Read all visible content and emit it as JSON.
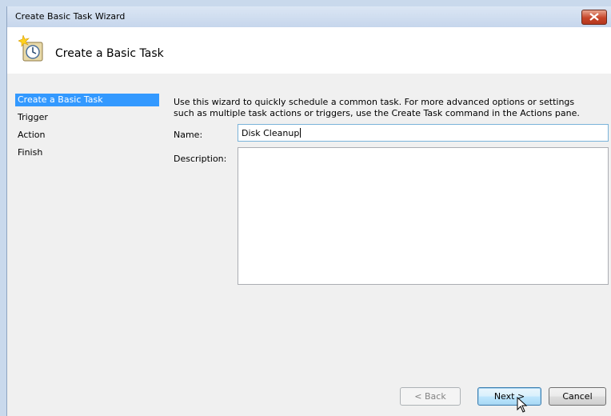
{
  "window": {
    "title": "Create Basic Task Wizard"
  },
  "header": {
    "title": "Create a Basic Task",
    "icon": "scheduled-task-clock-icon"
  },
  "steps": [
    {
      "label": "Create a Basic Task",
      "active": true
    },
    {
      "label": "Trigger",
      "active": false
    },
    {
      "label": "Action",
      "active": false
    },
    {
      "label": "Finish",
      "active": false
    }
  ],
  "main": {
    "intro_line1": "Use this wizard to quickly schedule a common task.  For more advanced options or settings",
    "intro_line2": "such as multiple task actions or triggers, use the Create Task command in the Actions pane.",
    "name_label": "Name:",
    "name_value": "Disk Cleanup",
    "description_label": "Description:",
    "description_value": ""
  },
  "buttons": {
    "back": "< Back",
    "next": "Next >",
    "cancel": "Cancel"
  },
  "colors": {
    "selection": "#3399ff",
    "titlebar": "#c6d6ec",
    "close": "#c7462a"
  }
}
